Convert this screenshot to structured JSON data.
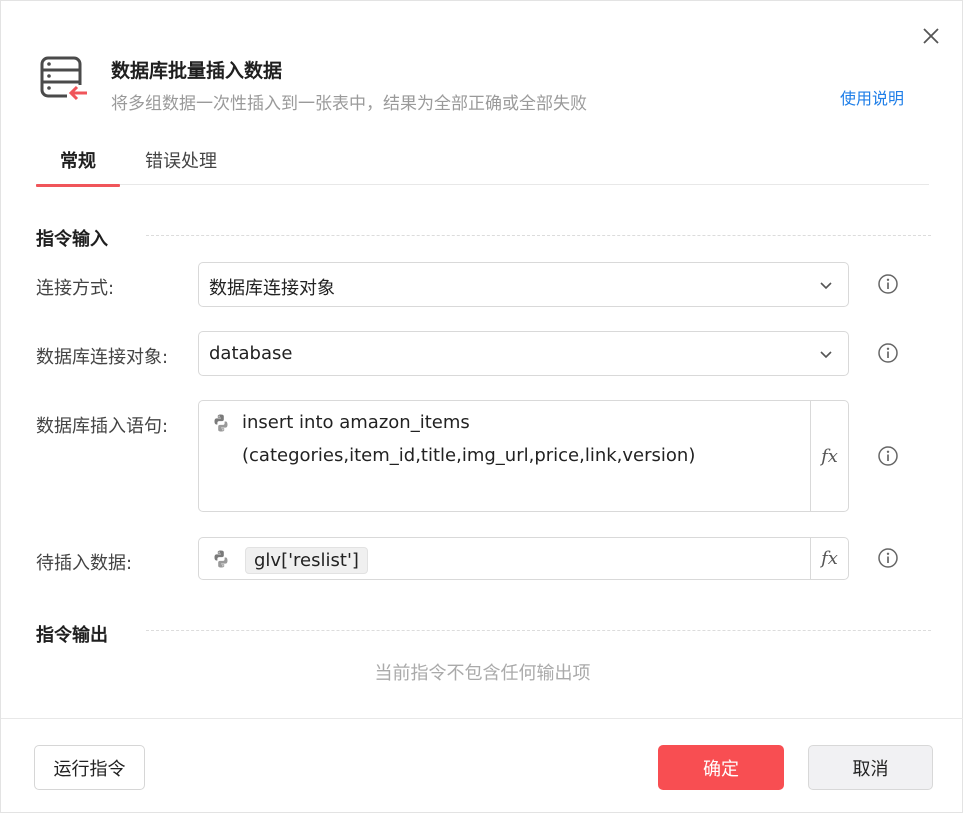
{
  "dialog": {
    "title": "数据库批量插入数据",
    "subtitle": "将多组数据一次性插入到一张表中，结果为全部正确或全部失败",
    "help_link": "使用说明",
    "icons": {
      "header": "database-insert-icon",
      "close": "close-icon"
    }
  },
  "tabs": [
    {
      "label": "常规",
      "active": true
    },
    {
      "label": "错误处理",
      "active": false
    }
  ],
  "input_section": {
    "title": "指令输入",
    "fields": {
      "connection_mode": {
        "label": "连接方式:",
        "value": "数据库连接对象"
      },
      "db_object": {
        "label": "数据库连接对象:",
        "value": "database"
      },
      "insert_sql": {
        "label": "数据库插入语句:",
        "line1": "insert into amazon_items",
        "line2": "(categories,item_id,title,img_url,price,link,version)"
      },
      "data_to_insert": {
        "label": "待插入数据:",
        "value": "glv['reslist']"
      }
    }
  },
  "output_section": {
    "title": "指令输出",
    "empty_text": "当前指令不包含任何输出项"
  },
  "footer": {
    "run_label": "运行指令",
    "ok_label": "确定",
    "cancel_label": "取消"
  },
  "colors": {
    "accent": "#f84e52",
    "link": "#1e7ee8",
    "tab_underline": "#f0555a"
  }
}
